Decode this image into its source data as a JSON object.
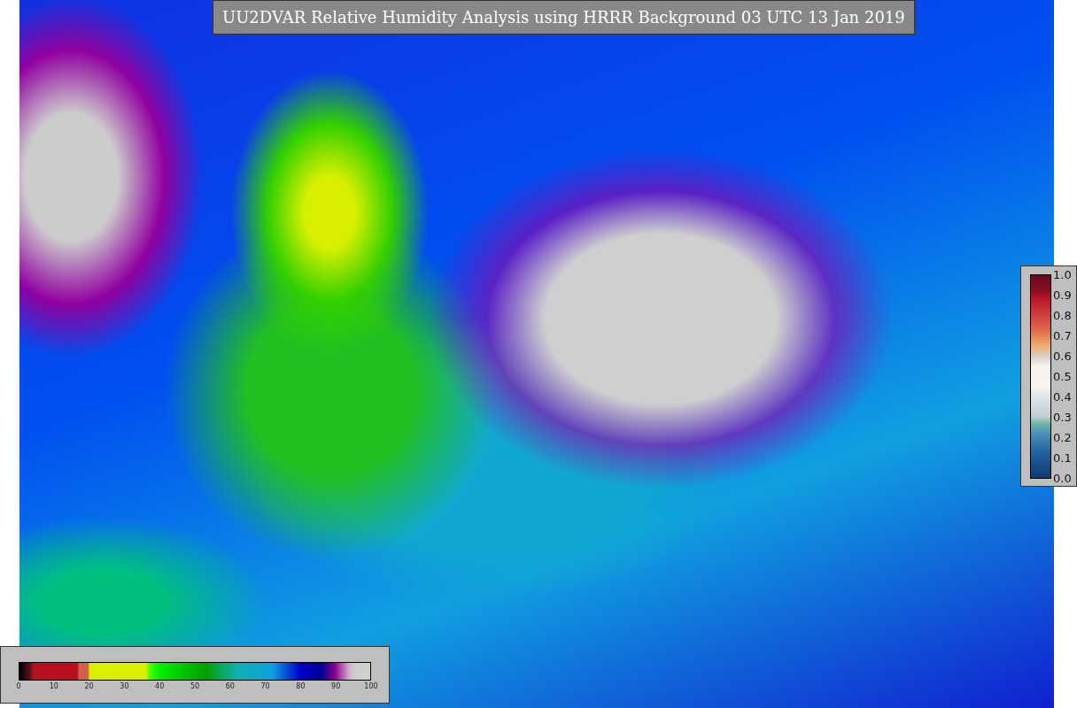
{
  "title": "UU2DVAR Relative Humidity Analysis using HRRR Background 03 UTC 13 Jan 2019",
  "humidity_colorbar": {
    "ticks": [
      "0",
      "10",
      "20",
      "30",
      "40",
      "50",
      "60",
      "70",
      "80",
      "90",
      "100"
    ]
  },
  "station_colorbar": {
    "ticks": [
      "1.0",
      "0.9",
      "0.8",
      "0.7",
      "0.6",
      "0.5",
      "0.4",
      "0.3",
      "0.2",
      "0.1",
      "0.0"
    ]
  }
}
